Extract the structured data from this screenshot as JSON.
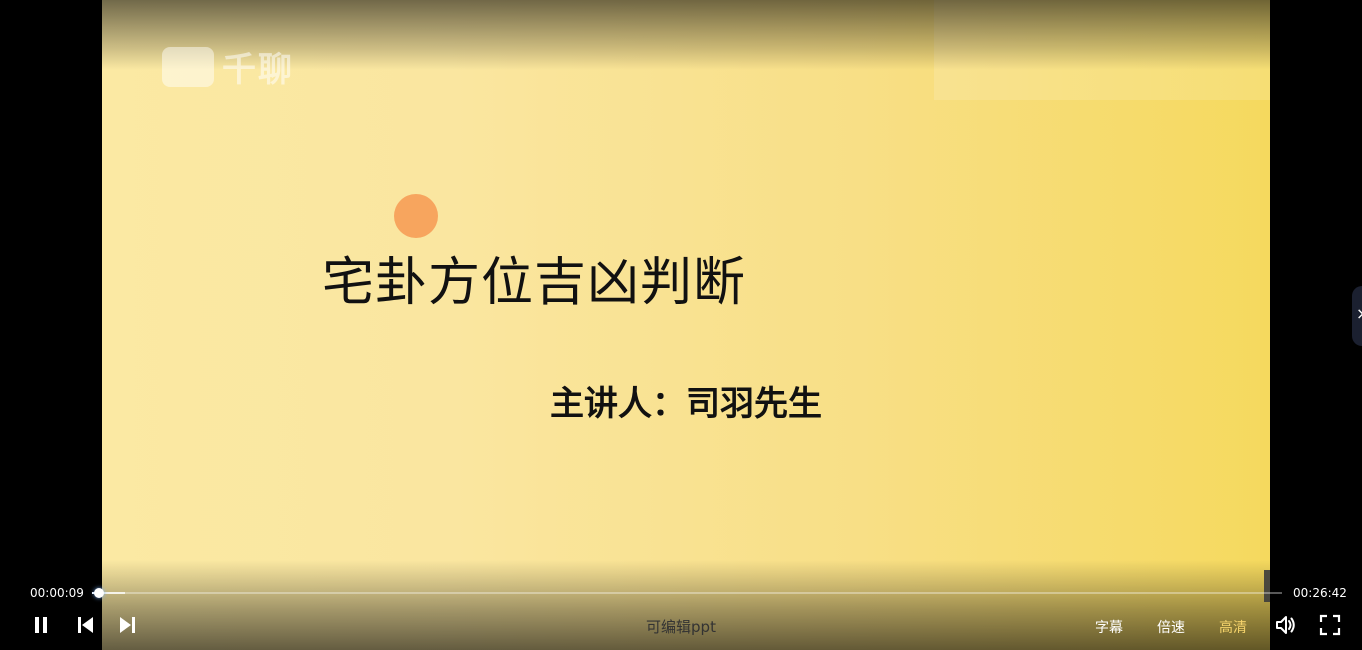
{
  "video": {
    "watermark_text": "千聊",
    "slide_title": "宅卦方位吉凶判断",
    "slide_speaker": "主讲人：司羽先生"
  },
  "controls": {
    "current_time": "00:00:09",
    "total_time": "00:26:42",
    "progress_fraction": 0.0056,
    "buffered_fraction": 0.028,
    "caption_text": "可编辑ppt",
    "subtitle_label": "字幕",
    "speed_label": "倍速",
    "quality_label": "高清",
    "icons": {
      "pause": "pause-icon",
      "previous": "skip-previous-icon",
      "next": "skip-next-icon",
      "volume": "volume-icon",
      "fullscreen": "fullscreen-icon",
      "side_tab": "close-icon"
    }
  },
  "colors": {
    "quality_active": "#f5d36b",
    "slide_accent_dot": "#f7a55e",
    "background": "#000000"
  }
}
